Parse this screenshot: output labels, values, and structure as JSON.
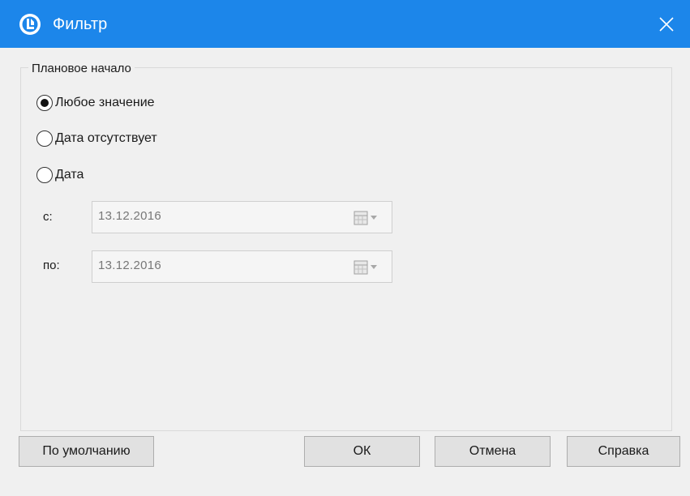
{
  "window": {
    "title": "Фильтр"
  },
  "group": {
    "title": "Плановое начало",
    "options": [
      {
        "label": "Любое значение",
        "selected": true
      },
      {
        "label": "Дата отсутствует",
        "selected": false
      },
      {
        "label": "Дата",
        "selected": false
      }
    ],
    "from": {
      "label": "с:",
      "value": "13.12.2016"
    },
    "to": {
      "label": "по:",
      "value": "13.12.2016"
    }
  },
  "buttons": {
    "default": "По умолчанию",
    "ok": "ОК",
    "cancel": "Отмена",
    "help": "Справка"
  },
  "colors": {
    "titlebar": "#1c86ea",
    "background": "#f0f0f0"
  },
  "icons": {
    "app": "app-logo-icon",
    "close": "close-icon",
    "calendar": "calendar-dropdown-icon"
  }
}
